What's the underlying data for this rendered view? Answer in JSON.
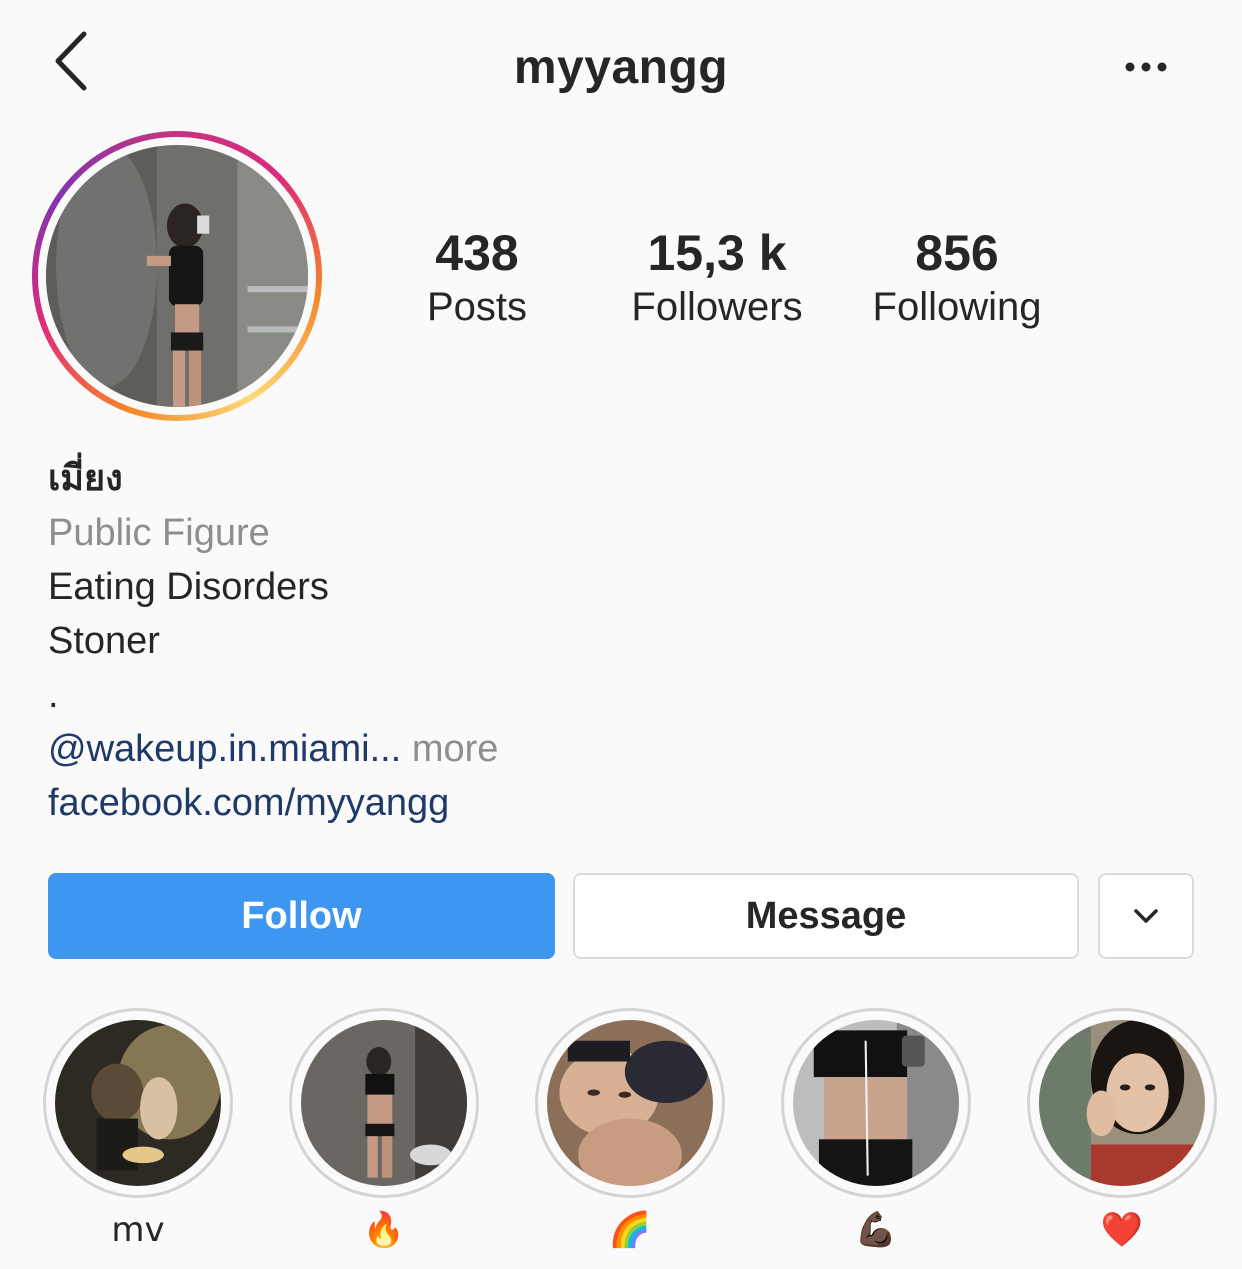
{
  "header": {
    "username": "myyangg",
    "back_icon": "chevron-left-icon",
    "more_icon": "more-horizontal-icon"
  },
  "profile": {
    "avatar_ring_colors": [
      "#f58529",
      "#dd2a7b",
      "#8134af"
    ]
  },
  "stats": [
    {
      "value": "438",
      "label": "Posts"
    },
    {
      "value": "15,3 k",
      "label": "Followers"
    },
    {
      "value": "856",
      "label": "Following"
    }
  ],
  "bio": {
    "name": "เมี่ยง",
    "category": "Public Figure",
    "lines": [
      "Eating Disorders",
      "Stoner",
      "."
    ],
    "mention": "@wakeup.in.miami...",
    "more": "more",
    "link": "facebook.com/myyangg"
  },
  "actions": {
    "follow_label": "Follow",
    "message_label": "Message",
    "dropdown_icon": "chevron-down-icon",
    "follow_color": "#3f96f0"
  },
  "highlights": [
    {
      "label": "mv"
    },
    {
      "label": "🔥"
    },
    {
      "label": "🌈"
    },
    {
      "label": "💪🏿"
    },
    {
      "label": "❤️"
    }
  ]
}
